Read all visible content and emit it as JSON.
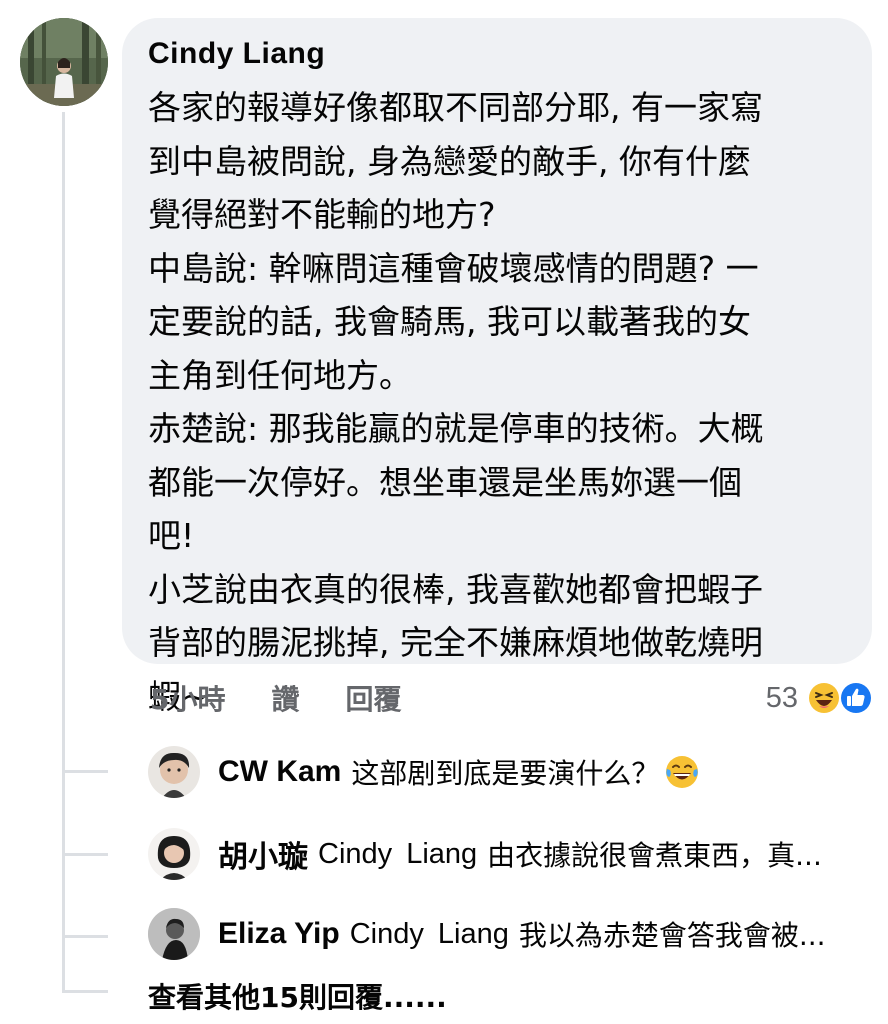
{
  "comment": {
    "author": "Cindy  Liang",
    "text": "各家的報導好像都取不同部分耶, 有一家寫\n到中島被問說, 身為戀愛的敵手, 你有什麼\n覺得絕對不能輸的地方?\n中島說: 幹嘛問這種會破壞感情的問題? 一\n定要說的話, 我會騎馬, 我可以載著我的女\n主角到任何地方。\n赤楚說: 那我能贏的就是停車的技術。大概\n都能一次停好。想坐車還是坐馬妳選一個\n吧!\n小芝說由衣真的很棒, 我喜歡她都會把蝦子\n背部的腸泥挑掉, 完全不嫌麻煩地做乾燒明\n蝦~",
    "time": "5小時",
    "like_label": "讚",
    "reply_label": "回覆",
    "reaction_count": "53",
    "reaction_icons": [
      "haha-reaction-icon",
      "like-reaction-icon"
    ]
  },
  "replies": [
    {
      "name": "CW Kam",
      "mention": "",
      "text": "这部剧到底是要演什么？",
      "emoji": "laughing-tears-emoji"
    },
    {
      "name": "胡小璇",
      "mention": "Cindy  Liang",
      "text": "由衣據說很會煮東西，真...",
      "emoji": ""
    },
    {
      "name": "Eliza Yip",
      "mention": "Cindy  Liang",
      "text": "我以為赤楚會答我會被...",
      "emoji": ""
    }
  ],
  "more_replies_label": "查看其他15則回覆......",
  "colors": {
    "bubble": "#eff1f4",
    "meta_text": "#65676b",
    "like_blue": "#1877f2",
    "haha_yellow": "#f7c134",
    "thread_line": "#dcdfe3"
  }
}
